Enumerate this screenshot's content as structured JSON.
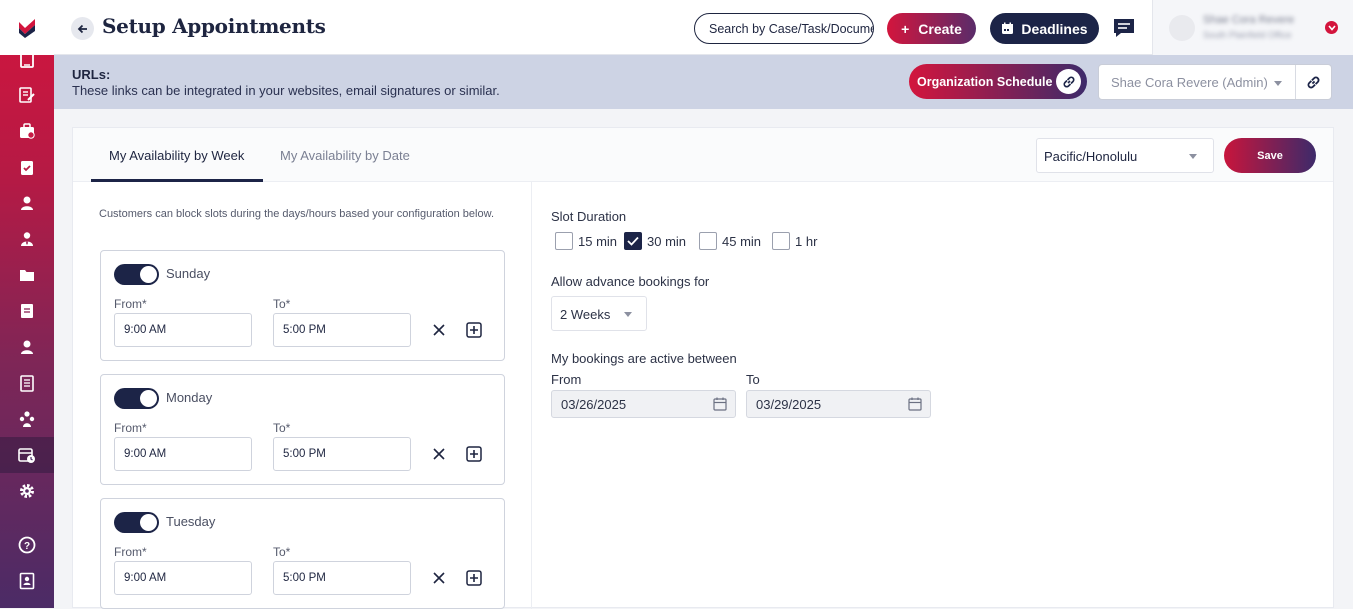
{
  "header": {
    "title": "Setup Appointments",
    "search_placeholder": "Search by Case/Task/Document",
    "create_label": "Create",
    "deadlines_label": "Deadlines",
    "user_name": "Shae Cora Revere",
    "user_office": "South Plainfield Office"
  },
  "urlbar": {
    "title": "URLs:",
    "description": "These links can be integrated in your websites, email signatures or similar.",
    "org_schedule_label": "Organization Schedule",
    "admin_select_value": "Shae Cora Revere (Admin)"
  },
  "tabs": [
    {
      "label": "My Availability by Week",
      "active": true
    },
    {
      "label": "My Availability by Date",
      "active": false
    }
  ],
  "timezone": "Pacific/Honolulu",
  "save_label": "Save",
  "availability": {
    "help_text": "Customers can block slots during the days/hours based your configuration below.",
    "from_label": "From*",
    "to_label": "To*",
    "days": [
      {
        "name": "Sunday",
        "enabled": true,
        "from": "9:00 AM",
        "to": "5:00 PM"
      },
      {
        "name": "Monday",
        "enabled": true,
        "from": "9:00 AM",
        "to": "5:00 PM"
      },
      {
        "name": "Tuesday",
        "enabled": true,
        "from": "9:00 AM",
        "to": "5:00 PM"
      }
    ]
  },
  "settings": {
    "slot_duration_label": "Slot Duration",
    "slot_options": [
      {
        "label": "15 min",
        "checked": false
      },
      {
        "label": "30 min",
        "checked": true
      },
      {
        "label": "45 min",
        "checked": false
      },
      {
        "label": "1 hr",
        "checked": false
      }
    ],
    "advance_label": "Allow advance bookings for",
    "advance_value": "2 Weeks",
    "active_between_label": "My bookings are active between",
    "from_label": "From",
    "to_label": "To",
    "from_date": "03/26/2025",
    "to_date": "03/29/2025"
  },
  "colors": {
    "brand_red": "#d3153d",
    "brand_navy": "#1c2447",
    "brand_purple": "#4b2b66"
  }
}
